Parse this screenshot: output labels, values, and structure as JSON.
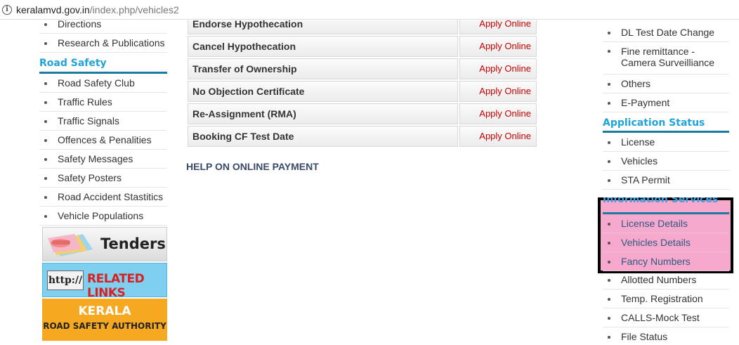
{
  "browser": {
    "url_host": "keralamvd.gov.in",
    "url_path": "/index.php/vehicles2"
  },
  "left": {
    "top_items": [
      "Directions",
      "Research & Publications"
    ],
    "road_safety": {
      "title": "Road Safety",
      "items": [
        "Road Safety Club",
        "Traffic Rules",
        "Traffic Signals",
        "Offences & Penalities",
        "Safety Messages",
        "Safety Posters",
        "Road Accident Stastitics",
        "Vehicle Populations"
      ]
    },
    "banners": {
      "tenders": "Tenders",
      "related_http": "http://",
      "related_links": "RELATED LINKS",
      "kerala": "KERALA",
      "rsa": "ROAD SAFETY AUTHORITY"
    }
  },
  "services": {
    "rows": [
      {
        "name": "Endorse Hypothecation",
        "action": "Apply Online"
      },
      {
        "name": "Cancel Hypothecation",
        "action": "Apply Online"
      },
      {
        "name": "Transfer of Ownership",
        "action": "Apply Online"
      },
      {
        "name": "No Objection Certificate",
        "action": "Apply Online"
      },
      {
        "name": "Re-Assignment (RMA)",
        "action": "Apply Online"
      },
      {
        "name": "Booking CF Test Date",
        "action": "Apply Online"
      }
    ],
    "help_heading": "HELP ON ONLINE PAYMENT"
  },
  "right": {
    "top_items": [
      "DL Test Date Change",
      "Fine remittance - Camera Surveilliance",
      "Others",
      "E-Payment"
    ],
    "application_status": {
      "title": "Application Status",
      "items": [
        "License",
        "Vehicles",
        "STA Permit"
      ]
    },
    "information_services": {
      "title": "Information Services",
      "items": [
        "License Details",
        "Vehicles Details",
        "Fancy Numbers"
      ]
    },
    "more_items": [
      "Allotted Numbers",
      "Temp. Registration",
      "CALLS-Mock Test",
      "File Status"
    ]
  },
  "colors": {
    "section_heading": "#1fa3d9",
    "heading_rule": "#1a7aa0",
    "apply_link": "#cc0000",
    "highlight": "#f7a8cd",
    "highlight_border": "#000000"
  }
}
